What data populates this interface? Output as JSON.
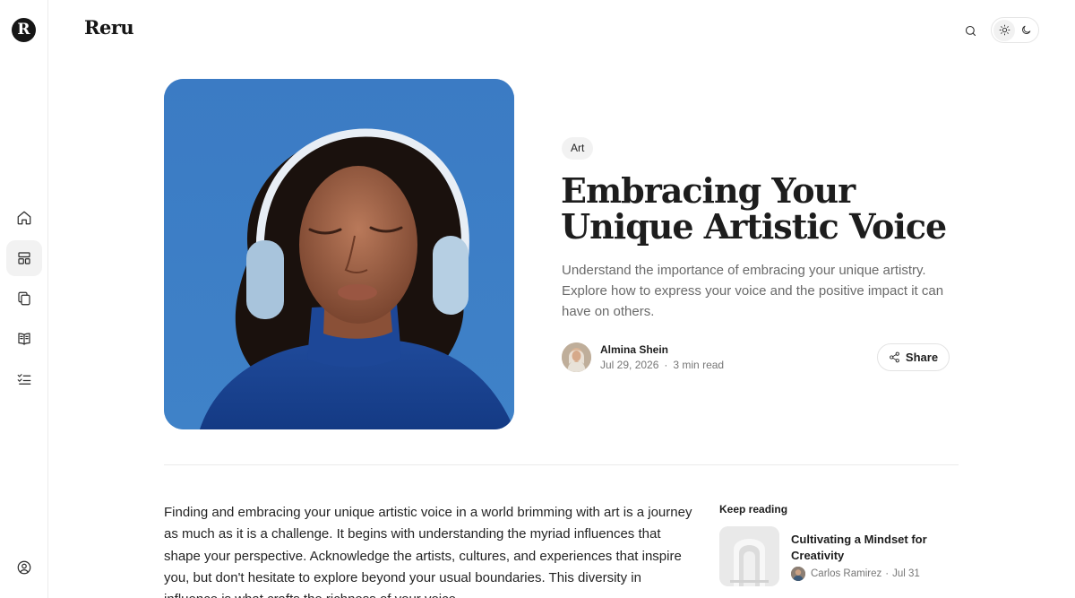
{
  "sidebar": {
    "logo_letter": "R",
    "items": [
      {
        "icon": "home-icon",
        "active": false
      },
      {
        "icon": "layout-icon",
        "active": true
      },
      {
        "icon": "copy-icon",
        "active": false
      },
      {
        "icon": "book-open-icon",
        "active": false
      },
      {
        "icon": "checklist-icon",
        "active": false
      }
    ],
    "bottom_icon": "user-circle-icon"
  },
  "header": {
    "brand": "Reru",
    "search_icon": "search-icon",
    "theme_toggle": {
      "options": [
        "sun-icon",
        "moon-icon"
      ],
      "selected": "light"
    }
  },
  "article": {
    "tag": "Art",
    "title": "Embracing Your Unique Artistic Voice",
    "excerpt": "Understand the importance of embracing your unique artistry. Explore how to express your voice and the positive impact it can have on others.",
    "author": {
      "name": "Almina Shein",
      "date": "Jul 29, 2026",
      "separator": "·",
      "read_time": "3 min read"
    },
    "share_label": "Share",
    "body": "Finding and embracing your unique artistic voice in a world brimming with art is a journey as much as it is a challenge. It begins with understanding the myriad influences that shape your perspective. Acknowledge the artists, cultures, and experiences that inspire you, but don't hesitate to explore beyond your usual boundaries. This diversity in influence is what crafts the richness of your voice."
  },
  "keep_reading": {
    "heading": "Keep reading",
    "items": [
      {
        "title": "Cultivating a Mindset for Creativity",
        "author": "Carlos Ramirez",
        "separator": "·",
        "date": "Jul 31"
      }
    ]
  },
  "colors": {
    "accent": "#161616",
    "hero_bg": "#3d7dc2",
    "muted_text": "#6a6a6a"
  }
}
